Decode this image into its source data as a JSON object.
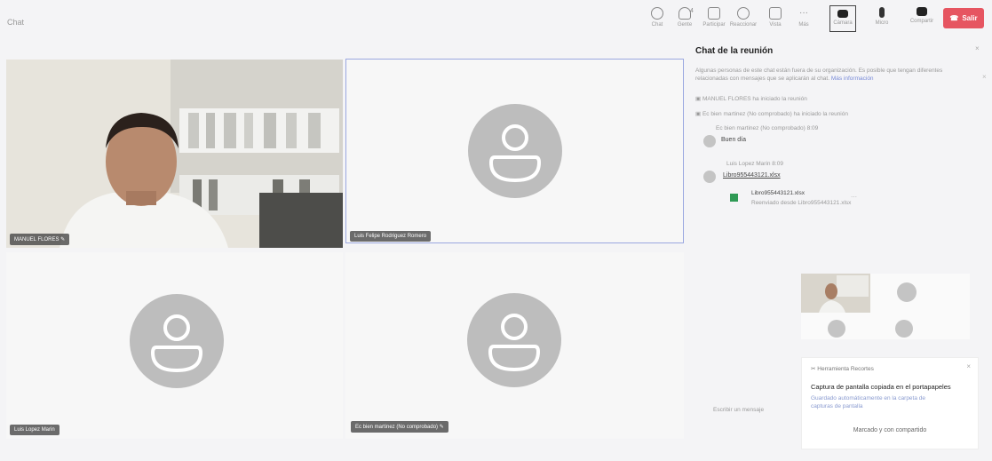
{
  "meeting": {
    "title": "Chat"
  },
  "toolbar": {
    "chat": "Chat",
    "people": "Gente",
    "people_count": "4",
    "raise": "Participar",
    "react": "Reaccionar",
    "view": "Vista",
    "more": "Más",
    "camera": "Cámara",
    "mic": "Micro",
    "share": "Compartir",
    "leave": "Salir"
  },
  "participants": [
    {
      "name": "MANUEL FLORES"
    },
    {
      "name": "Luis Felipe Rodriguez Romero"
    },
    {
      "name": "Luis Lopez Marin"
    },
    {
      "name": "Ec bien martinez (No comprobado)"
    }
  ],
  "chat": {
    "title": "Chat de la reunión",
    "notice": "Algunas personas de este chat están fuera de su organización. Es posible que tengan diferentes",
    "notice2": "relacionadas con mensajes que se aplicarán al chat.",
    "notice_link": "Más información",
    "event1": "MANUEL FLORES ha iniciado la reunión",
    "event2": "Ec bien martinez (No comprobado) ha iniciado la reunión",
    "time1": "Ec bien martinez (No comprobado) 8:09",
    "msg1": "Buen día",
    "time2": "Luis Lopez Marin 8:09",
    "file_link": "Libro955443121.xlsx",
    "file_name": "Libro955443121.xlsx",
    "file_sub": "Reenviado desde Libro955443121.xlsx"
  },
  "toast": {
    "app": "Herramienta Recortes",
    "title": "Captura de pantalla copiada en el portapapeles",
    "body1": "Guardado automáticamente en la carpeta de",
    "body2": "capturas de pantalla",
    "action": "Marcado y con compartido"
  },
  "compose": {
    "placeholder": "Escribir un mensaje"
  }
}
